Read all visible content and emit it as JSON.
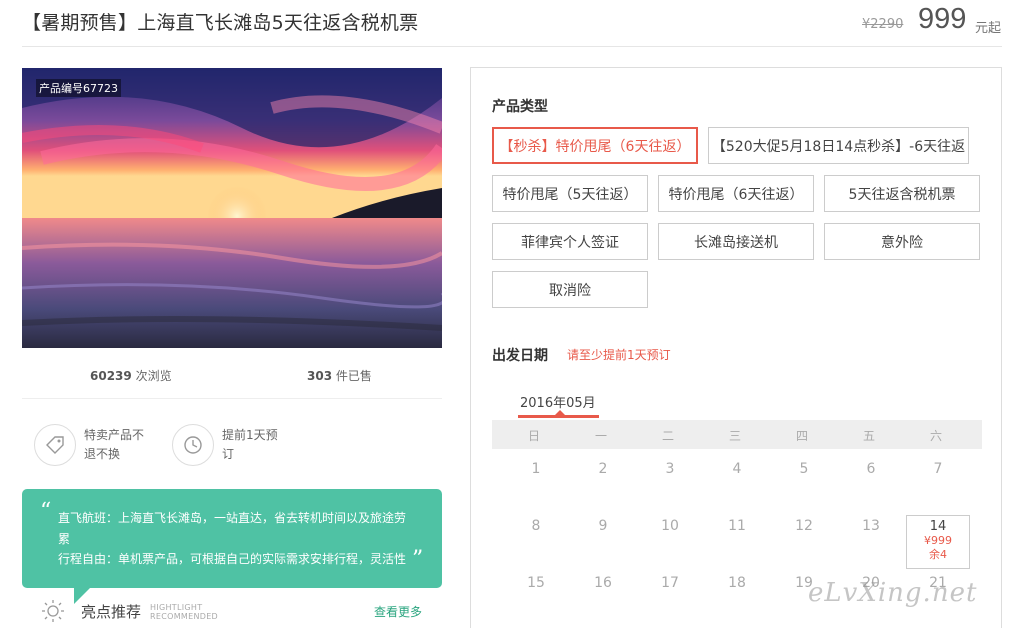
{
  "header": {
    "title": "【暑期预售】上海直飞长滩岛5天往返含税机票",
    "old_price": "¥2290",
    "price": "999",
    "price_unit": "元起"
  },
  "gallery": {
    "product_code": "产品编号67723"
  },
  "stats": {
    "views_count": "60239",
    "views_label": "次浏览",
    "sold_count": "303",
    "sold_label": "件已售"
  },
  "features": [
    {
      "icon": "tag-icon",
      "text": "特卖产品不退不换"
    },
    {
      "icon": "clock-icon",
      "text": "提前1天预订"
    }
  ],
  "highlights": {
    "line1": "直飞航班：上海直飞长滩岛，一站直达，省去转机时间以及旅途劳累",
    "line2": "行程自由：单机票产品，可根据自己的实际需求安排行程，灵活性",
    "title": "亮点推荐",
    "title_en_1": "HIGHTLIGHT",
    "title_en_2": "RECOMMENDED",
    "more": "查看更多"
  },
  "product_types": {
    "label": "产品类型",
    "options": [
      "【秒杀】特价甩尾（6天往返）",
      "【520大促5月18日14点秒杀】-6天往返",
      "特价甩尾（5天往返）",
      "特价甩尾（6天往返）",
      "5天往返含税机票",
      "菲律宾个人签证",
      "长滩岛接送机",
      "意外险",
      "取消险"
    ],
    "selected_index": 0
  },
  "departure": {
    "label": "出发日期",
    "hint": "请至少提前1天预订",
    "month": "2016年05月",
    "weekdays": [
      "日",
      "一",
      "二",
      "三",
      "四",
      "五",
      "六"
    ],
    "row1": [
      "1",
      "2",
      "3",
      "4",
      "5",
      "6",
      "7"
    ],
    "row2": [
      "8",
      "9",
      "10",
      "11",
      "12",
      "13"
    ],
    "row3": [
      "15",
      "16",
      "17",
      "18",
      "19",
      "20",
      "21"
    ],
    "available_day": {
      "day": "14",
      "price": "¥999",
      "stock": "余4"
    }
  },
  "watermark": "eLvXing.net",
  "colors": {
    "accent": "#e8594a",
    "green": "#4fc2a4",
    "link_green": "#2aa57f"
  }
}
